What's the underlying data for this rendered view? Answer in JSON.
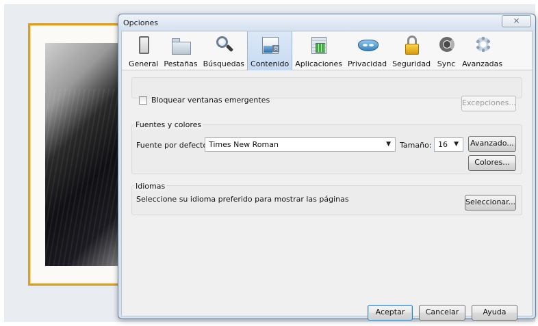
{
  "window": {
    "title": "Opciones",
    "close_glyph": "⨯"
  },
  "tabs": [
    {
      "label": "General",
      "icon": "general-icon",
      "active": false
    },
    {
      "label": "Pestañas",
      "icon": "tabs-icon",
      "active": false
    },
    {
      "label": "Búsquedas",
      "icon": "search-icon",
      "active": false
    },
    {
      "label": "Contenido",
      "icon": "content-icon",
      "active": true
    },
    {
      "label": "Aplicaciones",
      "icon": "applications-icon",
      "active": false
    },
    {
      "label": "Privacidad",
      "icon": "privacy-mask-icon",
      "active": false
    },
    {
      "label": "Seguridad",
      "icon": "lock-icon",
      "active": false
    },
    {
      "label": "Sync",
      "icon": "sync-icon",
      "active": false
    },
    {
      "label": "Avanzadas",
      "icon": "gear-icon",
      "active": false
    }
  ],
  "popups": {
    "checkbox_label": "Bloquear ventanas emergentes",
    "checked": false,
    "exceptions_button": "Excepciones..."
  },
  "fonts": {
    "legend": "Fuentes y colores",
    "default_font_label": "Fuente por defecto:",
    "default_font_value": "Times New Roman",
    "size_label": "Tamaño:",
    "size_value": "16",
    "advanced_button": "Avanzado...",
    "colors_button": "Colores..."
  },
  "languages": {
    "legend": "Idiomas",
    "description": "Seleccione su idioma preferido para mostrar las páginas",
    "select_button": "Seleccionar..."
  },
  "footer": {
    "ok_button": "Aceptar",
    "cancel_button": "Cancelar",
    "help_button": "Ayuda"
  },
  "colors": {
    "frame_gold": "#d9a123",
    "active_tab": "#c6daf2",
    "default_button_border": "#3c7fb1"
  }
}
